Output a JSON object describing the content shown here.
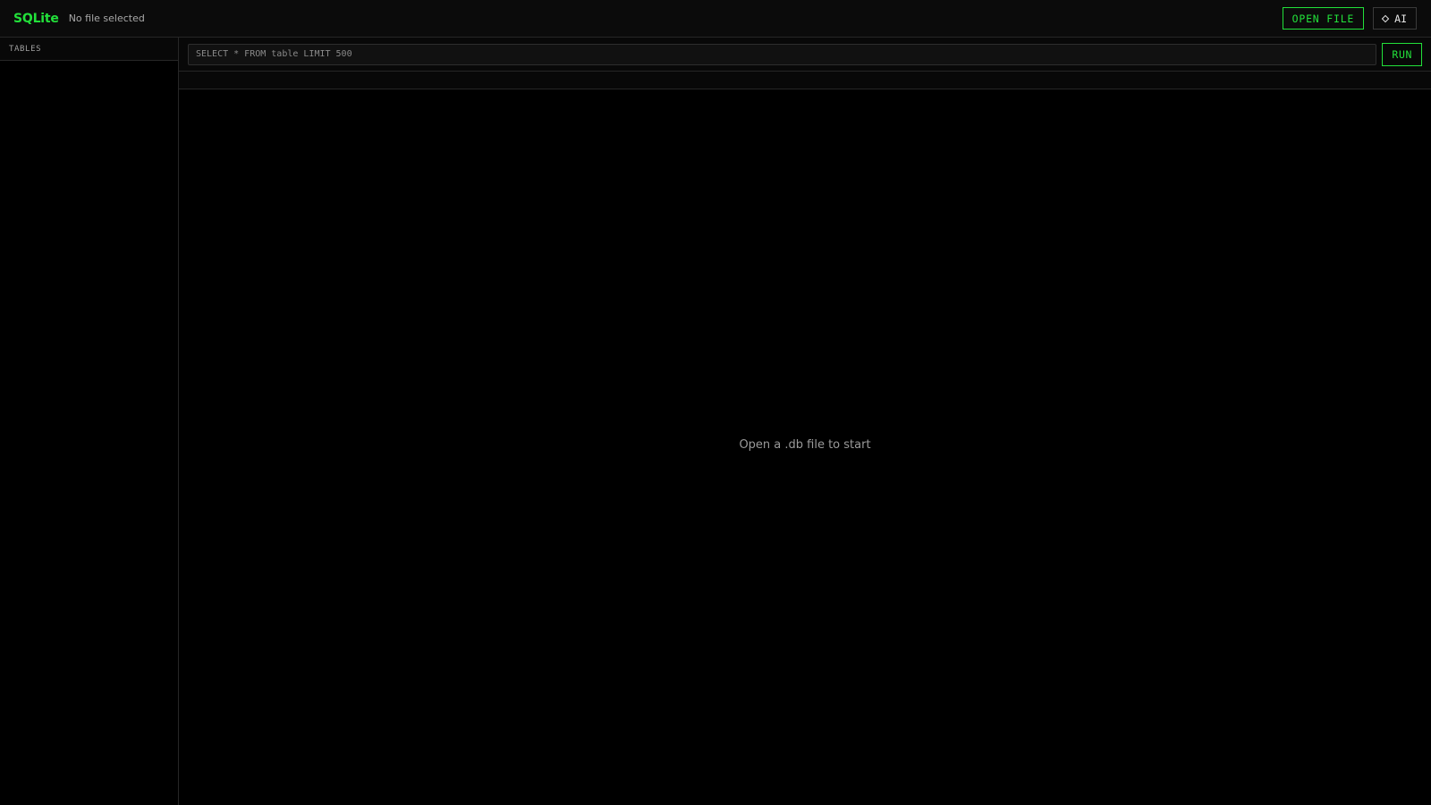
{
  "header": {
    "app_title": "SQLite",
    "file_status": "No file selected",
    "open_file_label": "OPEN FILE",
    "ai_label": "AI",
    "ai_icon": "diamond-icon"
  },
  "sidebar": {
    "header": "TABLES",
    "items": []
  },
  "query": {
    "placeholder": "SELECT * FROM table LIMIT 500",
    "value": "",
    "run_label": "RUN"
  },
  "results": {
    "empty_message": "Open a .db file to start"
  },
  "colors": {
    "accent": "#22e03a",
    "background": "#000000",
    "panel": "#0b0b0b",
    "border": "#262626"
  }
}
